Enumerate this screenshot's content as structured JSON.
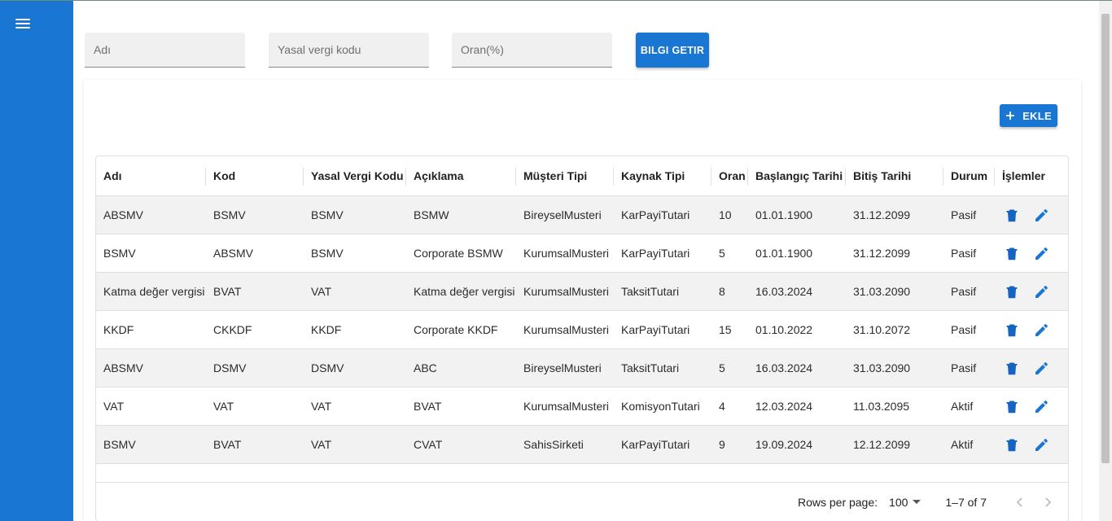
{
  "filters": {
    "name_placeholder": "Adı",
    "tax_code_placeholder": "Yasal vergi kodu",
    "rate_placeholder": "Oran(%)",
    "fetch_button": "BILGI GETIR"
  },
  "toolbar": {
    "add_label": "EKLE"
  },
  "table": {
    "columns": [
      "Adı",
      "Kod",
      "Yasal Vergi Kodu",
      "Açıklama",
      "Müşteri Tipi",
      "Kaynak Tipi",
      "Oran",
      "Başlangıç Tarihi",
      "Bitiş Tarihi",
      "Durum",
      "İşlemler"
    ],
    "rows": [
      [
        "ABSMV",
        "BSMV",
        "BSMV",
        "BSMW",
        "BireyselMusteri",
        "KarPayiTutari",
        "10",
        "01.01.1900",
        "31.12.2099",
        "Pasif"
      ],
      [
        "BSMV",
        "ABSMV",
        "BSMV",
        "Corporate BSMW",
        "KurumsalMusteri",
        "KarPayiTutari",
        "5",
        "01.01.1900",
        "31.12.2099",
        "Pasif"
      ],
      [
        "Katma değer vergisi",
        "BVAT",
        "VAT",
        "Katma değer vergisi",
        "KurumsalMusteri",
        "TaksitTutari",
        "8",
        "16.03.2024",
        "31.03.2090",
        "Pasif"
      ],
      [
        "KKDF",
        "CKKDF",
        "KKDF",
        "Corporate KKDF",
        "KurumsalMusteri",
        "KarPayiTutari",
        "15",
        "01.10.2022",
        "31.10.2072",
        "Pasif"
      ],
      [
        "ABSMV",
        "DSMV",
        "DSMV",
        "ABC",
        "BireyselMusteri",
        "TaksitTutari",
        "5",
        "16.03.2024",
        "31.03.2090",
        "Pasif"
      ],
      [
        "VAT",
        "VAT",
        "VAT",
        "BVAT",
        "KurumsalMusteri",
        "KomisyonTutari",
        "4",
        "12.03.2024",
        "11.03.2095",
        "Aktif"
      ],
      [
        "BSMV",
        "BVAT",
        "VAT",
        "CVAT",
        "SahisSirketi",
        "KarPayiTutari",
        "9",
        "19.09.2024",
        "12.12.2099",
        "Aktif"
      ]
    ]
  },
  "pagination": {
    "rows_per_page_label": "Rows per page:",
    "rows_per_page_value": "100",
    "range_label": "1–7 of 7"
  },
  "colors": {
    "primary": "#1976d2",
    "delete_icon": "#1565c0",
    "edit_icon": "#1976d2"
  },
  "icons": [
    "menu-icon",
    "plus-icon",
    "delete-icon",
    "edit-icon",
    "dropdown-arrow-icon",
    "chevron-left-icon",
    "chevron-right-icon"
  ]
}
